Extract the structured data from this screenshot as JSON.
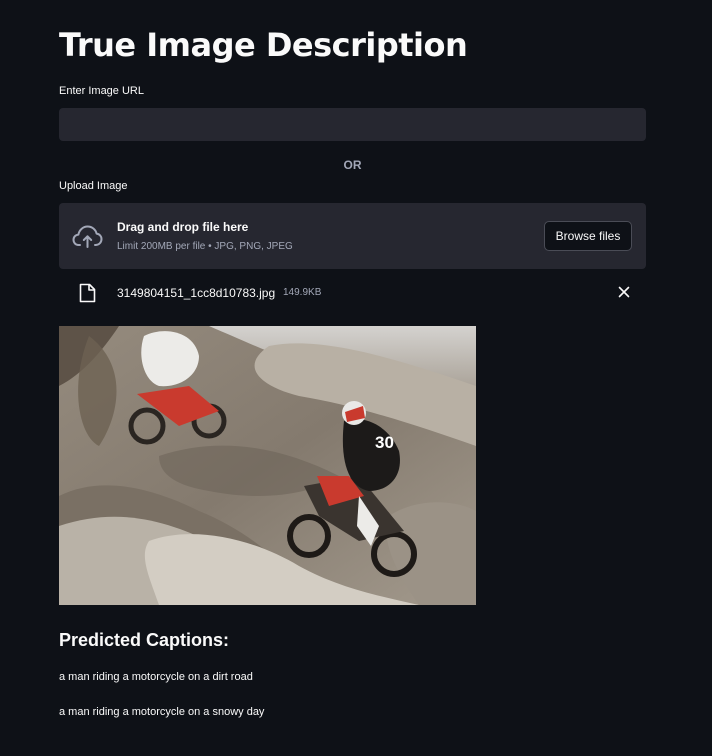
{
  "page": {
    "title": "True Image Description"
  },
  "url_field": {
    "label": "Enter Image URL",
    "value": "",
    "placeholder": ""
  },
  "separator": "OR",
  "uploader": {
    "label": "Upload Image",
    "drop_text": "Drag and drop file here",
    "limit_text": "Limit 200MB per file • JPG, PNG, JPEG",
    "browse_label": "Browse files",
    "icon": "cloud-upload-icon"
  },
  "uploaded_file": {
    "name": "3149804151_1cc8d10783.jpg",
    "size": "149.9KB",
    "icon": "file-icon",
    "remove_icon": "close-icon"
  },
  "captions": {
    "heading": "Predicted Captions:",
    "items": [
      "a man riding a motorcycle on a dirt road",
      "a man riding a motorcycle on a snowy day"
    ]
  },
  "colors": {
    "background": "#0e1117",
    "input_background": "#262730",
    "text": "#fafafa",
    "muted_text": "#a3a8b8"
  }
}
